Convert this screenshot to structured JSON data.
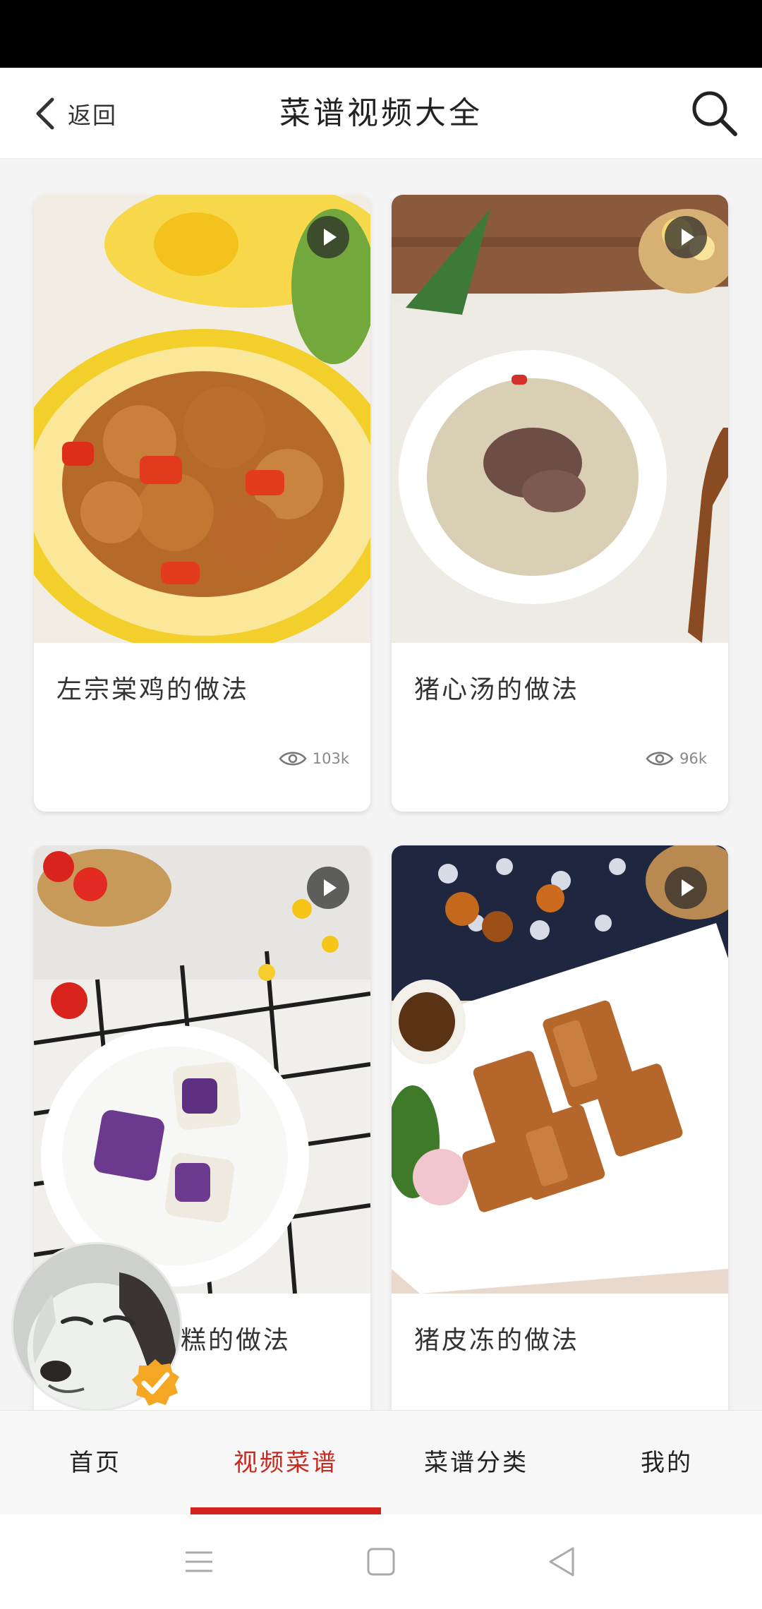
{
  "nav": {
    "back_label": "返回",
    "title": "菜谱视频大全"
  },
  "recipes": [
    {
      "title": "左宗棠鸡的做法",
      "views": "103k"
    },
    {
      "title": "猪心汤的做法",
      "views": "96k"
    },
    {
      "title": "糕的做法",
      "views": ""
    },
    {
      "title": "猪皮冻的做法",
      "views": ""
    }
  ],
  "tabs": [
    {
      "label": "首页"
    },
    {
      "label": "视频菜谱"
    },
    {
      "label": "菜谱分类"
    },
    {
      "label": "我的"
    }
  ],
  "icons": {
    "back": "chevron-left-icon",
    "search": "search-icon",
    "play": "play-icon",
    "views": "eye-icon",
    "verified": "check-badge-icon",
    "sys_menu": "menu-icon",
    "sys_home": "square-icon",
    "sys_back": "triangle-back-icon"
  },
  "colors": {
    "accent": "#d3231a",
    "active_tab_text": "#c8281d",
    "badge": "#f5a623"
  }
}
